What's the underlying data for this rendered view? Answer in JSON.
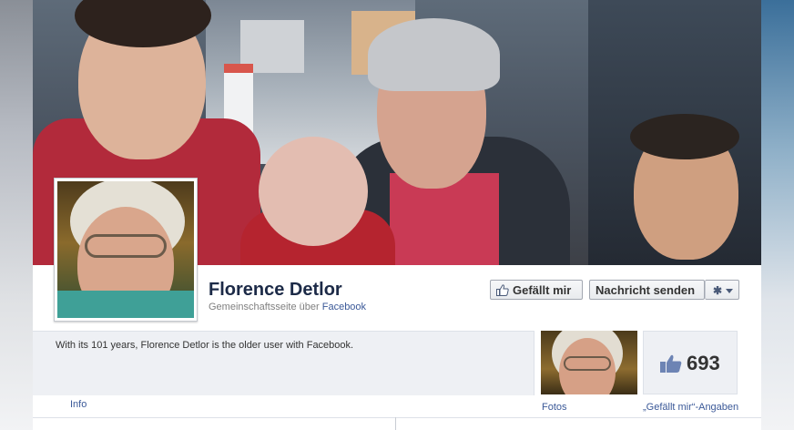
{
  "profile": {
    "name": "Florence Detlor",
    "subtitle_prefix": "Gemeinschaftsseite über ",
    "subtitle_link": "Facebook"
  },
  "actions": {
    "like_label": "Gefällt mir",
    "message_label": "Nachricht senden",
    "gear_icon": "gear-icon",
    "thumb_icon": "thumbs-up-icon"
  },
  "about": {
    "text": "With its 101 years, Florence Detlor is the older user with Facebook.",
    "info_label": "Info"
  },
  "photos": {
    "label": "Fotos"
  },
  "likes": {
    "count": "693",
    "label": "„Gefällt mir“-Angaben"
  },
  "colors": {
    "brand": "#3b5998",
    "name_text": "#1c2a47",
    "panel_bg": "#eef0f4"
  }
}
